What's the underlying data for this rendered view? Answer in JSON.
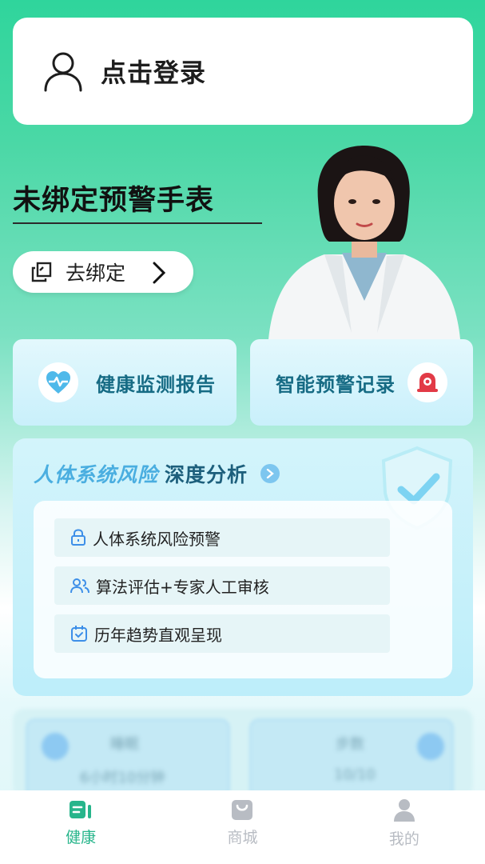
{
  "login": {
    "label": "点击登录",
    "icon": "user-outline-icon"
  },
  "hero": {
    "title": "未绑定预警手表",
    "bind_button": "去绑定"
  },
  "features": [
    {
      "label": "健康监测报告",
      "icon": "heart-pulse-icon",
      "color": "#4fb9ea"
    },
    {
      "label": "智能预警记录",
      "icon": "alarm-bell-icon",
      "color": "#e23a46"
    }
  ],
  "analysis": {
    "title_highlight": "人体系统风险",
    "title_rest": "深度分析",
    "items": [
      {
        "label": "人体系统风险预警",
        "icon": "lock-icon"
      },
      {
        "label": "算法评估+专家人工审核",
        "icon": "users-icon"
      },
      {
        "label": "历年趋势直观呈现",
        "icon": "calendar-check-icon"
      }
    ]
  },
  "blurred": {
    "left_title": "睡眠",
    "left_sub": "6小时10分钟",
    "right_title": "步数",
    "right_sub": "10/10"
  },
  "tabbar": {
    "items": [
      {
        "label": "健康",
        "icon": "health-report-icon",
        "active": true
      },
      {
        "label": "商城",
        "icon": "shopping-bag-icon",
        "active": false
      },
      {
        "label": "我的",
        "icon": "profile-icon",
        "active": false
      }
    ]
  },
  "colors": {
    "accent": "#27b58b",
    "card_text": "#166b84"
  }
}
